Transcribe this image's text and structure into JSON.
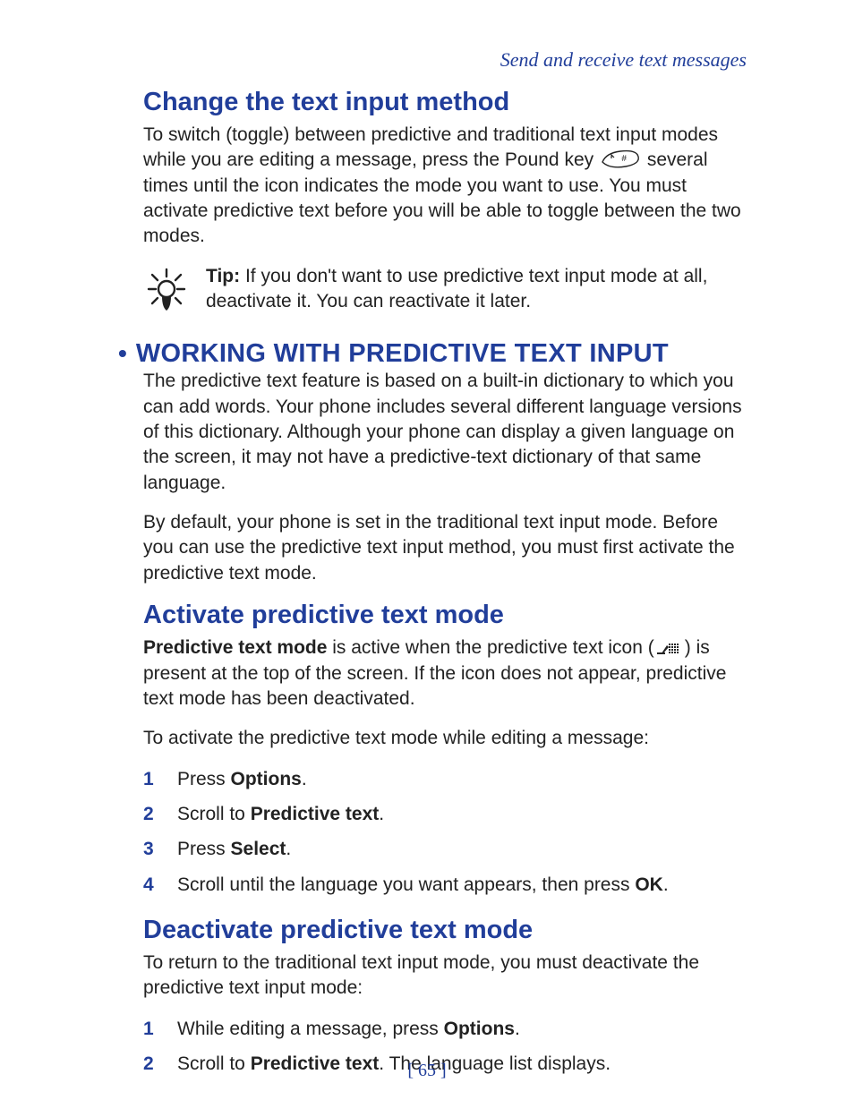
{
  "chapter": "Send and receive text messages",
  "s1": {
    "heading": "Change the text input method",
    "p1a": "To switch (toggle) between predictive and traditional text input modes while you are editing a message, press the Pound key ",
    "p1b": " several times until the icon indicates the mode you want to use. You must activate predictive text before you will be able to toggle between the two modes.",
    "tip_label": "Tip:",
    "tip_body": " If you don't want to use predictive text input mode at all, deactivate it. You can reactivate it later."
  },
  "s2": {
    "heading": "WORKING WITH PREDICTIVE TEXT INPUT",
    "p1": "The predictive text feature is based on a built-in dictionary to which you can add words. Your phone includes several different language versions of this dictionary. Although your phone can display a given language on the screen, it may not have a predictive-text dictionary of that same language.",
    "p2": "By default, your phone is set in the traditional text input mode. Before you can use the predictive text input method, you must first activate the predictive text mode."
  },
  "s3": {
    "heading": "Activate predictive text mode",
    "p1_bold": "Predictive text mode",
    "p1_mid": " is active when the predictive text icon (",
    "p1_end": ") is present at the top of the screen. If the icon does not appear, predictive text mode has been deactivated.",
    "p2": "To activate the predictive text mode while editing a message:",
    "steps": {
      "step1_pre": "Press ",
      "step1_bold": "Options",
      "step1_post": ".",
      "step2_pre": "Scroll to ",
      "step2_bold": "Predictive text",
      "step2_post": ".",
      "step3_pre": "Press ",
      "step3_bold": "Select",
      "step3_post": ".",
      "step4_pre": "Scroll until the language you want appears, then press ",
      "step4_bold": "OK",
      "step4_post": "."
    }
  },
  "s4": {
    "heading": "Deactivate predictive text mode",
    "p1": "To return to the traditional text input mode, you must deactivate the predictive text input mode:",
    "steps": {
      "step1_pre": "While editing a message, press ",
      "step1_bold": "Options",
      "step1_post": ".",
      "step2_pre": "Scroll to ",
      "step2_bold": "Predictive text",
      "step2_post": ". The language list displays."
    }
  },
  "page_number": "[ 65 ]"
}
